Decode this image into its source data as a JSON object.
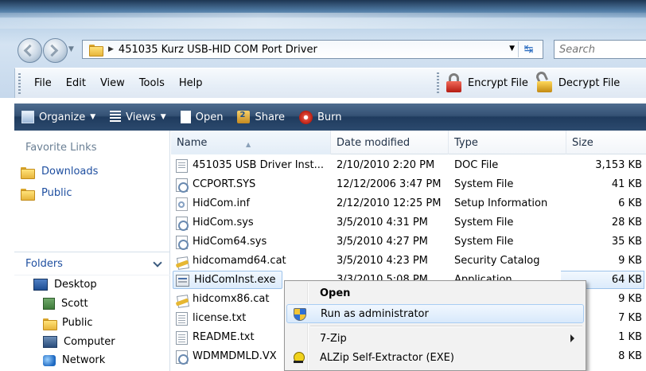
{
  "address": {
    "path": "451035 Kurz USB-HID COM Port Driver",
    "search_placeholder": "Search"
  },
  "menubar": {
    "items": [
      "File",
      "Edit",
      "View",
      "Tools",
      "Help"
    ],
    "encrypt_label": "Encrypt File",
    "decrypt_label": "Decrypt File"
  },
  "commandbar": {
    "organize": "Organize",
    "views": "Views",
    "open": "Open",
    "share": "Share",
    "burn": "Burn"
  },
  "navpane": {
    "favorite_links_heading": "Favorite Links",
    "favorites": [
      "Downloads",
      "Public"
    ],
    "folders_heading": "Folders",
    "tree": [
      "Desktop",
      "Scott",
      "Public",
      "Computer",
      "Network"
    ]
  },
  "filelist": {
    "columns": {
      "name": "Name",
      "date": "Date modified",
      "type": "Type",
      "size": "Size"
    },
    "rows": [
      {
        "icon": "doc-file-icon",
        "name": "451035 USB Driver Inst...",
        "date": "2/10/2010 2:20 PM",
        "type": "DOC File",
        "size": "3,153 KB"
      },
      {
        "icon": "system-file-icon",
        "name": "CCPORT.SYS",
        "date": "12/12/2006 3:47 PM",
        "type": "System File",
        "size": "41 KB"
      },
      {
        "icon": "setup-info-icon",
        "name": "HidCom.inf",
        "date": "2/12/2010 12:25 PM",
        "type": "Setup Information",
        "size": "6 KB"
      },
      {
        "icon": "system-file-icon",
        "name": "HidCom.sys",
        "date": "3/5/2010 4:31 PM",
        "type": "System File",
        "size": "28 KB"
      },
      {
        "icon": "system-file-icon",
        "name": "HidCom64.sys",
        "date": "3/5/2010 4:27 PM",
        "type": "System File",
        "size": "35 KB"
      },
      {
        "icon": "security-catalog-icon",
        "name": "hidcomamd64.cat",
        "date": "3/5/2010 4:23 PM",
        "type": "Security Catalog",
        "size": "9 KB"
      },
      {
        "icon": "application-icon",
        "name": "HidComInst.exe",
        "date": "3/3/2010 5:08 PM",
        "type": "Application",
        "size": "64 KB"
      },
      {
        "icon": "security-catalog-icon",
        "name": "hidcomx86.cat",
        "date": "",
        "type": "",
        "size": "9 KB"
      },
      {
        "icon": "text-file-icon",
        "name": "license.txt",
        "date": "",
        "type": "",
        "size": "7 KB"
      },
      {
        "icon": "text-file-icon",
        "name": "README.txt",
        "date": "",
        "type": "",
        "size": "1 KB"
      },
      {
        "icon": "system-file-icon",
        "name": "WDMMDMLD.VX",
        "date": "",
        "type": "",
        "size": "8 KB"
      }
    ]
  },
  "context_menu": {
    "open": "Open",
    "run_as_admin": "Run as administrator",
    "seven_zip": "7-Zip",
    "alzip": "ALZip Self-Extractor (EXE)"
  }
}
